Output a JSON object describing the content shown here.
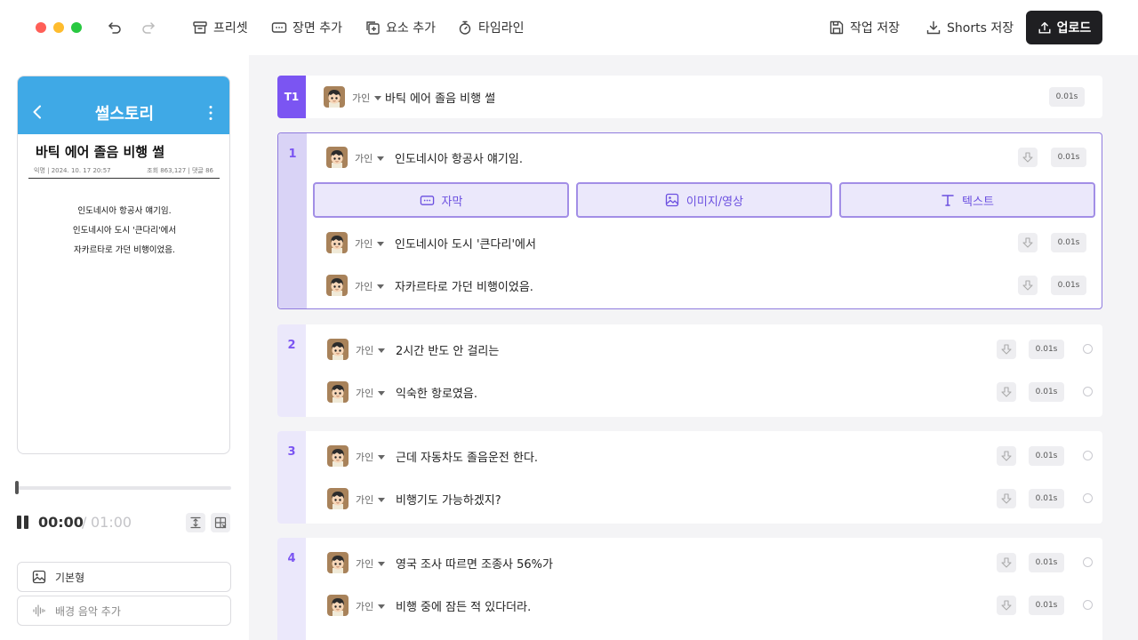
{
  "toolbar": {
    "preset_label": "프리셋",
    "add_scene_label": "장면 추가",
    "add_element_label": "요소 추가",
    "timeline_label": "타임라인",
    "save_work_label": "작업 저장",
    "save_shorts_label": "Shorts 저장",
    "upload_label": "업로드"
  },
  "preview": {
    "header_title": "썰스토리",
    "post_title": "바틱 에어 졸음 비행 썰",
    "meta_left": "익명 | 2024. 10. 17 20:57",
    "meta_right": "조회 863,127 | 댓글 86",
    "lines": [
      "인도네시아 항공사 얘기임.",
      "인도네시아 도시 '큰다리'에서",
      "자카르타로 가던 비행이었음."
    ]
  },
  "player": {
    "current_time": "00:00",
    "separator": "/",
    "total_time": "01:00",
    "progress": 0
  },
  "panel": {
    "template_label": "기본형",
    "bgm_label": "배경 음악 추가"
  },
  "title_card": {
    "label": "T1",
    "speaker": "가인",
    "text": "바틱 에어 졸음 비행 썰",
    "duration": "0.01s"
  },
  "scenes": [
    {
      "number": "1",
      "lines": [
        {
          "speaker": "가인",
          "text": "인도네시아 항공사 얘기임.",
          "duration": "0.01s"
        },
        {
          "speaker": "가인",
          "text": "인도네시아 도시 '큰다리'에서",
          "duration": "0.01s"
        },
        {
          "speaker": "가인",
          "text": "자카르타로 가던 비행이었음.",
          "duration": "0.01s"
        }
      ],
      "actions": {
        "subtitle": "자막",
        "image_video": "이미지/영상",
        "text": "텍스트"
      }
    },
    {
      "number": "2",
      "lines": [
        {
          "speaker": "가인",
          "text": "2시간 반도 안 걸리는",
          "duration": "0.01s"
        },
        {
          "speaker": "가인",
          "text": "익숙한 항로였음.",
          "duration": "0.01s"
        }
      ]
    },
    {
      "number": "3",
      "lines": [
        {
          "speaker": "가인",
          "text": "근데 자동차도 졸음운전 한다.",
          "duration": "0.01s"
        },
        {
          "speaker": "가인",
          "text": "비행기도 가능하겠지?",
          "duration": "0.01s"
        }
      ]
    },
    {
      "number": "4",
      "lines": [
        {
          "speaker": "가인",
          "text": "영국 조사 따르면 조종사 56%가",
          "duration": "0.01s"
        },
        {
          "speaker": "가인",
          "text": "비행 중에 잠든 적 있다더라.",
          "duration": "0.01s"
        }
      ]
    }
  ],
  "colors": {
    "accent": "#7b55f2",
    "preview_header": "#3fa9e6",
    "upload_button": "#1f1f22"
  }
}
